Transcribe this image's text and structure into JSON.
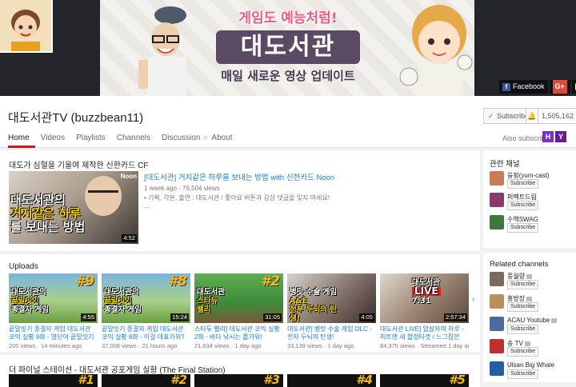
{
  "banner": {
    "title_top": "게임도 예능처럼!",
    "title_main": "대도서관",
    "title_sub": "매일 새로운 영상 업데이트",
    "social": {
      "facebook": "Facebook",
      "googleplus": "G+"
    }
  },
  "channel": {
    "title": "대도서관TV (buzzbean11)",
    "subscribe_label": "Subscribed",
    "sub_count": "1,505,162",
    "tabs": [
      "Home",
      "Videos",
      "Playlists",
      "Channels",
      "Discussion",
      "About"
    ],
    "active_tab": "Home",
    "also_subscribed_label": "Also subscribed",
    "also_subscribed": [
      "H",
      "Y"
    ],
    "also_colors": [
      "#7b2fbe",
      "#6a1b9a"
    ]
  },
  "featured": {
    "section_title": "대도가 심혈을 기울여 제작한 신한카드 CF",
    "thumb_text_1": "대도서관의",
    "thumb_text_2": "거지같은 하루",
    "thumb_text_3": "를 보내는 방법",
    "thumb_badge": "Noon",
    "duration": "4:52",
    "title": "[대도서관] 거지같은 하루를 보내는 방법 with 신한카드 Noon",
    "meta": "1 week ago · 76,504 views",
    "desc": "• 기획, 각본, 출연 : 대도서관 / 좋아요 버튼과 감상 댓글을 잊지 마세요!",
    "more": "..."
  },
  "uploads": {
    "section_title": "Uploads",
    "videos": [
      {
        "num": "#9",
        "cap1": "대도서관의",
        "cap2": "끝말잇기",
        "cap3": "종결자 게임",
        "duration": "4:55",
        "title": "끝말잇기 종결자 게임 대도서관 코믹 실황 9화 - 영단어 끝말잇기로...",
        "views": "200 views",
        "age": "14 minutes ago"
      },
      {
        "num": "#8",
        "cap1": "대도서관의",
        "cap2": "끝말잇기",
        "cap3": "종결자 게임",
        "duration": "15:24",
        "title": "끝말잇기 종결자 게임 대도서관 코믹 실황 8화 - 이걸 대표가위? 노...",
        "views": "37,008 views",
        "age": "21 hours ago"
      },
      {
        "num": "#2",
        "cap1": "대도서관",
        "cap2": "스타듀",
        "cap3": "밸리",
        "duration": "31:05",
        "title": "스타듀 밸리] 대도서관 코믹 실황 2화 - 바다 낚시는 즐거워!",
        "views": "21,634 views",
        "age": "1 day ago"
      },
      {
        "num": "",
        "cap1": "병맛 수술 게임",
        "cap2": "A&E",
        "cap3": "전부 두뇌의 탄생!",
        "duration": "4:05",
        "title": "대도서관] 병맛 수술 게임 DLC - 전자 두뇌의 탄생!",
        "views": "33,139 views",
        "age": "1 day ago"
      },
      {
        "num": "",
        "cap1": "대도서관",
        "cap2": "LIVE",
        "cap3": "7.31",
        "duration": "2:57:34",
        "title": "대도서관 LIVE] 암살자의 하루 - 히트맨 새 합정타겟 / 느그집안 이...",
        "views": "84,375 views",
        "age": "Streamed 1 day ago"
      }
    ]
  },
  "playlist": {
    "section_title": "더 파이널 스테이션 - 대도서관 공포게임 실황 (The Final Station)",
    "numbers": [
      "#1",
      "#2",
      "#3",
      "#4",
      "#5"
    ]
  },
  "sidebar": {
    "related_title": "관련 채널",
    "related": [
      {
        "name": "융핑(yum-cast)",
        "sub": "Subscribe",
        "color": "#c97b5a"
      },
      {
        "name": "퍼펙트드림",
        "sub": "Subscribe",
        "color": "#8a3a6a"
      },
      {
        "name": "수액SWAG",
        "sub": "Subscribe",
        "color": "#3a7a3a"
      }
    ],
    "channels_title": "Related channels",
    "channels": [
      {
        "name": "풍월량",
        "sub": "Subscribe",
        "color": "#7a6a5a"
      },
      {
        "name": "홍방장",
        "sub": "Subscribe",
        "color": "#b89060"
      },
      {
        "name": "ACAU Youtube",
        "sub": "Subscribe",
        "color": "#4a6aa0"
      },
      {
        "name": "송 TV",
        "sub": "Subscribe",
        "color": "#c03030"
      },
      {
        "name": "Ulsan Big Whale",
        "sub": "Subscribe",
        "color": "#2060a0"
      }
    ]
  }
}
